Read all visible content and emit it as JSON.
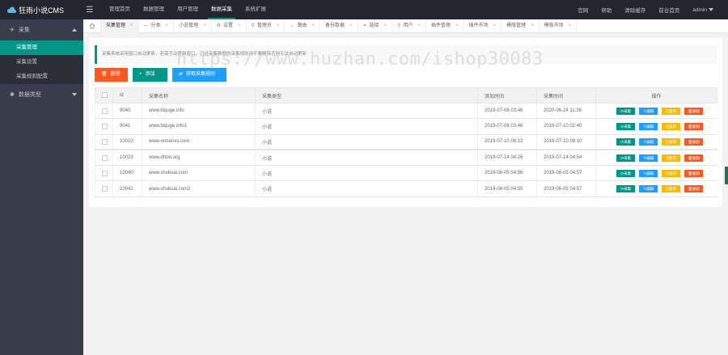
{
  "app": {
    "title": "狂雨小说CMS"
  },
  "topnav": {
    "items": [
      {
        "label": "管理首页",
        "active": false
      },
      {
        "label": "数据管理",
        "active": false
      },
      {
        "label": "用户管理",
        "active": false
      },
      {
        "label": "数据采集",
        "active": true
      },
      {
        "label": "系统扩展",
        "active": false
      }
    ],
    "right": [
      "官网",
      "帮助",
      "清除缓存",
      "前台首页"
    ],
    "user": "admin"
  },
  "sidebar": {
    "group1": {
      "label": "采集",
      "items": [
        "采集管理",
        "采集设置",
        "采集规则配置"
      ]
    },
    "group2": {
      "label": "数据类型"
    }
  },
  "tabs": [
    {
      "label": "采集管理",
      "active": true
    },
    {
      "label": "分类",
      "icon": "—"
    },
    {
      "label": "小说管理"
    },
    {
      "label": "设置",
      "icon": "⚙"
    },
    {
      "label": "管理员",
      "icon": "⚲"
    },
    {
      "label": "路由",
      "icon": "↔"
    },
    {
      "label": "备份数据"
    },
    {
      "label": "链接",
      "icon": "⚭"
    },
    {
      "label": "用户",
      "icon": "⚲"
    },
    {
      "label": "插件管理"
    },
    {
      "label": "插件市场"
    },
    {
      "label": "模版管理"
    },
    {
      "label": "模板市场"
    }
  ],
  "notice": "采集系统采用窗口自动更新，若需手动更新窗口，已经采集数据的采集规则请不要删除否则无法自动更新",
  "watermark": "https://www.huzhan.com/ishop30083",
  "buttons": {
    "delete": "删除",
    "add": "添加",
    "fetch": "获取采集规则"
  },
  "table": {
    "headers": {
      "id": "id",
      "name": "采集名称",
      "type": "采集类型",
      "created": "添加时间",
      "collected": "采集时间",
      "ops": "操作"
    },
    "op_labels": {
      "collect": "采集",
      "edit": "编辑",
      "copy": "复制",
      "delete": "删除"
    },
    "rows": [
      {
        "id": "9040",
        "name": "www.biquge.info",
        "type": "小说",
        "created": "2019-07-08 03:46",
        "collected": "2020-06-24 11:36"
      },
      {
        "id": "9041",
        "name": "www.biquge.info1",
        "type": "小说",
        "created": "2019-07-08 03:46",
        "collected": "2019-07-10 02:40"
      },
      {
        "id": "10010",
        "name": "www.remenxs.com",
        "type": "小说",
        "created": "2019-07-10 06:13",
        "collected": "2019-07-10 06:10"
      },
      {
        "id": "10023",
        "name": "www.dhzw.org",
        "type": "小说",
        "created": "2019-07-14 04:26",
        "collected": "2019-07-14 04:54"
      },
      {
        "id": "10040",
        "name": "www.shukuai.com",
        "type": "小说",
        "created": "2019-08-05 04:56",
        "collected": "2019-08-05 04:57"
      },
      {
        "id": "10042",
        "name": "www.shukuai.com2",
        "type": "小说",
        "created": "2019-08-05 04:55",
        "collected": "2019-08-05 04:57"
      }
    ]
  },
  "colors": {
    "accent": "#009688",
    "danger": "#ff5722",
    "info": "#1e9fff",
    "warning": "#ffb800",
    "topbar": "#23262e",
    "sidebar": "#393d49"
  }
}
